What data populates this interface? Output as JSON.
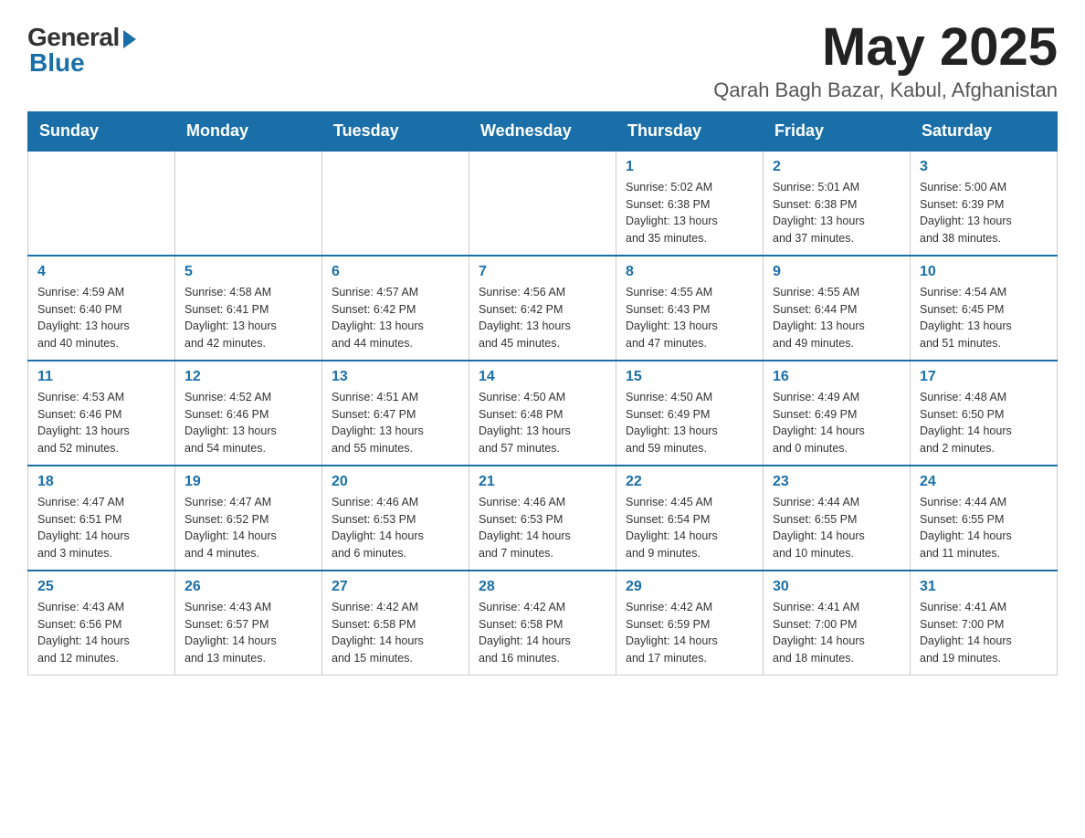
{
  "header": {
    "logo_general": "General",
    "logo_blue": "Blue",
    "month_title": "May 2025",
    "location": "Qarah Bagh Bazar, Kabul, Afghanistan"
  },
  "days_of_week": [
    "Sunday",
    "Monday",
    "Tuesday",
    "Wednesday",
    "Thursday",
    "Friday",
    "Saturday"
  ],
  "weeks": [
    [
      {
        "day": "",
        "info": ""
      },
      {
        "day": "",
        "info": ""
      },
      {
        "day": "",
        "info": ""
      },
      {
        "day": "",
        "info": ""
      },
      {
        "day": "1",
        "info": "Sunrise: 5:02 AM\nSunset: 6:38 PM\nDaylight: 13 hours\nand 35 minutes."
      },
      {
        "day": "2",
        "info": "Sunrise: 5:01 AM\nSunset: 6:38 PM\nDaylight: 13 hours\nand 37 minutes."
      },
      {
        "day": "3",
        "info": "Sunrise: 5:00 AM\nSunset: 6:39 PM\nDaylight: 13 hours\nand 38 minutes."
      }
    ],
    [
      {
        "day": "4",
        "info": "Sunrise: 4:59 AM\nSunset: 6:40 PM\nDaylight: 13 hours\nand 40 minutes."
      },
      {
        "day": "5",
        "info": "Sunrise: 4:58 AM\nSunset: 6:41 PM\nDaylight: 13 hours\nand 42 minutes."
      },
      {
        "day": "6",
        "info": "Sunrise: 4:57 AM\nSunset: 6:42 PM\nDaylight: 13 hours\nand 44 minutes."
      },
      {
        "day": "7",
        "info": "Sunrise: 4:56 AM\nSunset: 6:42 PM\nDaylight: 13 hours\nand 45 minutes."
      },
      {
        "day": "8",
        "info": "Sunrise: 4:55 AM\nSunset: 6:43 PM\nDaylight: 13 hours\nand 47 minutes."
      },
      {
        "day": "9",
        "info": "Sunrise: 4:55 AM\nSunset: 6:44 PM\nDaylight: 13 hours\nand 49 minutes."
      },
      {
        "day": "10",
        "info": "Sunrise: 4:54 AM\nSunset: 6:45 PM\nDaylight: 13 hours\nand 51 minutes."
      }
    ],
    [
      {
        "day": "11",
        "info": "Sunrise: 4:53 AM\nSunset: 6:46 PM\nDaylight: 13 hours\nand 52 minutes."
      },
      {
        "day": "12",
        "info": "Sunrise: 4:52 AM\nSunset: 6:46 PM\nDaylight: 13 hours\nand 54 minutes."
      },
      {
        "day": "13",
        "info": "Sunrise: 4:51 AM\nSunset: 6:47 PM\nDaylight: 13 hours\nand 55 minutes."
      },
      {
        "day": "14",
        "info": "Sunrise: 4:50 AM\nSunset: 6:48 PM\nDaylight: 13 hours\nand 57 minutes."
      },
      {
        "day": "15",
        "info": "Sunrise: 4:50 AM\nSunset: 6:49 PM\nDaylight: 13 hours\nand 59 minutes."
      },
      {
        "day": "16",
        "info": "Sunrise: 4:49 AM\nSunset: 6:49 PM\nDaylight: 14 hours\nand 0 minutes."
      },
      {
        "day": "17",
        "info": "Sunrise: 4:48 AM\nSunset: 6:50 PM\nDaylight: 14 hours\nand 2 minutes."
      }
    ],
    [
      {
        "day": "18",
        "info": "Sunrise: 4:47 AM\nSunset: 6:51 PM\nDaylight: 14 hours\nand 3 minutes."
      },
      {
        "day": "19",
        "info": "Sunrise: 4:47 AM\nSunset: 6:52 PM\nDaylight: 14 hours\nand 4 minutes."
      },
      {
        "day": "20",
        "info": "Sunrise: 4:46 AM\nSunset: 6:53 PM\nDaylight: 14 hours\nand 6 minutes."
      },
      {
        "day": "21",
        "info": "Sunrise: 4:46 AM\nSunset: 6:53 PM\nDaylight: 14 hours\nand 7 minutes."
      },
      {
        "day": "22",
        "info": "Sunrise: 4:45 AM\nSunset: 6:54 PM\nDaylight: 14 hours\nand 9 minutes."
      },
      {
        "day": "23",
        "info": "Sunrise: 4:44 AM\nSunset: 6:55 PM\nDaylight: 14 hours\nand 10 minutes."
      },
      {
        "day": "24",
        "info": "Sunrise: 4:44 AM\nSunset: 6:55 PM\nDaylight: 14 hours\nand 11 minutes."
      }
    ],
    [
      {
        "day": "25",
        "info": "Sunrise: 4:43 AM\nSunset: 6:56 PM\nDaylight: 14 hours\nand 12 minutes."
      },
      {
        "day": "26",
        "info": "Sunrise: 4:43 AM\nSunset: 6:57 PM\nDaylight: 14 hours\nand 13 minutes."
      },
      {
        "day": "27",
        "info": "Sunrise: 4:42 AM\nSunset: 6:58 PM\nDaylight: 14 hours\nand 15 minutes."
      },
      {
        "day": "28",
        "info": "Sunrise: 4:42 AM\nSunset: 6:58 PM\nDaylight: 14 hours\nand 16 minutes."
      },
      {
        "day": "29",
        "info": "Sunrise: 4:42 AM\nSunset: 6:59 PM\nDaylight: 14 hours\nand 17 minutes."
      },
      {
        "day": "30",
        "info": "Sunrise: 4:41 AM\nSunset: 7:00 PM\nDaylight: 14 hours\nand 18 minutes."
      },
      {
        "day": "31",
        "info": "Sunrise: 4:41 AM\nSunset: 7:00 PM\nDaylight: 14 hours\nand 19 minutes."
      }
    ]
  ]
}
